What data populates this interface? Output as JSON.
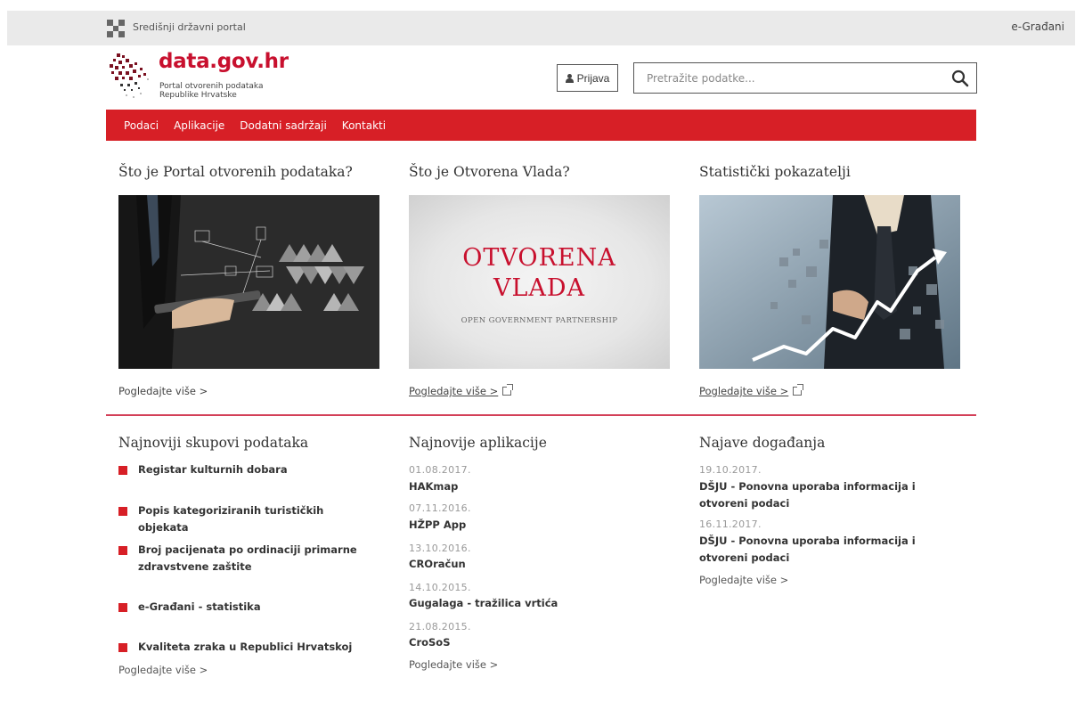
{
  "govbar": {
    "portal_name": "Središnji državni portal",
    "egradani": "e-Građani"
  },
  "brand": {
    "title": "data.gov.hr",
    "subtitle_line1": "Portal otvorenih podataka",
    "subtitle_line2": "Republike Hrvatske",
    "accent_color": "#c8102e"
  },
  "header": {
    "login_label": "Prijava",
    "search_placeholder": "Pretražite podatke..."
  },
  "nav": {
    "items": [
      "Podaci",
      "Aplikacije",
      "Dodatni sadržaji",
      "Kontakti"
    ],
    "bg_color": "#d71f26"
  },
  "features": [
    {
      "title": "Što je Portal otvorenih podataka?",
      "link": "Pogledajte više >"
    },
    {
      "title": "Što je Otvorena Vlada?",
      "link": "Pogledajte više >",
      "image_text_line1": "OTVORENA",
      "image_text_line2": "VLADA",
      "image_text_sub": "OPEN GOVERNMENT PARTNERSHIP"
    },
    {
      "title": "Statistički pokazatelji",
      "link": "Pogledajte više >"
    }
  ],
  "datasets": {
    "title": "Najnoviji skupovi podataka",
    "items": [
      "Registar kulturnih dobara",
      "Popis kategoriziranih turističkih objekata",
      "Broj pacijenata po ordinaciji primarne zdravstvene zaštite",
      "e-Građani - statistika",
      "Kvaliteta zraka u Republici Hrvatskoj"
    ],
    "more": "Pogledajte više >"
  },
  "apps": {
    "title": "Najnovije aplikacije",
    "items": [
      {
        "date": "01.08.2017.",
        "name": "HAKmap"
      },
      {
        "date": "07.11.2016.",
        "name": "HŽPP App"
      },
      {
        "date": "13.10.2016.",
        "name": "CROračun"
      },
      {
        "date": "14.10.2015.",
        "name": "Gugalaga - tražilica vrtića"
      },
      {
        "date": "21.08.2015.",
        "name": "CroSoS"
      }
    ],
    "more": "Pogledajte više >"
  },
  "events": {
    "title": "Najave događanja",
    "items": [
      {
        "date": "19.10.2017.",
        "name": "DŠJU - Ponovna uporaba informacija i otvoreni podaci"
      },
      {
        "date": "16.11.2017.",
        "name": "DŠJU - Ponovna uporaba informacija i otvoreni podaci"
      }
    ],
    "more": "Pogledajte više >"
  }
}
